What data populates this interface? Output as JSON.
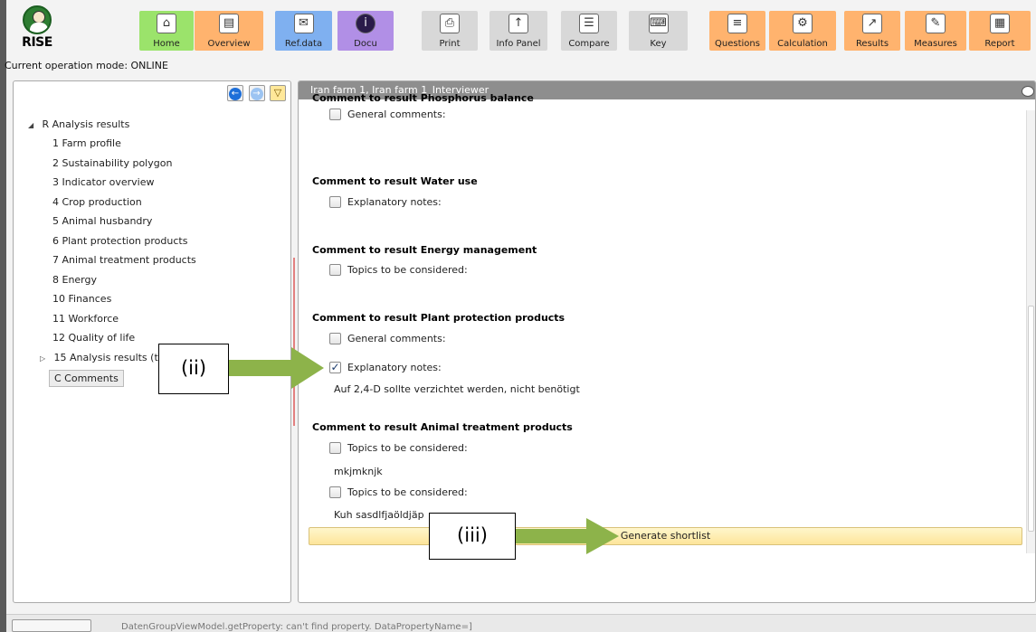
{
  "toolbar": {
    "logo_text": "RISE",
    "buttons": [
      {
        "label": "Home",
        "icon": "home-icon"
      },
      {
        "label": "Overview",
        "icon": "documents-icon"
      },
      {
        "label": "Ref.data",
        "icon": "envelope-icon"
      },
      {
        "label": "Docu",
        "icon": "info-icon"
      },
      {
        "label": "Print",
        "icon": "printer-icon"
      },
      {
        "label": "Info Panel",
        "icon": "upload-icon"
      },
      {
        "label": "Compare",
        "icon": "compare-icon"
      },
      {
        "label": "Key",
        "icon": "keyboard-icon"
      },
      {
        "label": "Questions",
        "icon": "questionnaire-icon"
      },
      {
        "label": "Calculation",
        "icon": "gear-icon"
      },
      {
        "label": "Results",
        "icon": "chart-icon"
      },
      {
        "label": "Measures",
        "icon": "wrench-icon"
      },
      {
        "label": "Report",
        "icon": "report-icon"
      }
    ],
    "colors": {
      "green": "#9be36b",
      "orange": "#ffb36e",
      "blue": "#7fb0f0",
      "purple": "#b18fe6",
      "grey": "#d8d8d8"
    }
  },
  "mode_text": "Current operation mode: ONLINE",
  "left_panel": {
    "root_label": "R Analysis results",
    "items": [
      "1 Farm profile",
      "2 Sustainability polygon",
      "3 Indicator overview",
      "4 Crop production",
      "5 Animal husbandry",
      "6 Plant protection products",
      "7 Animal treatment products",
      "8 Energy",
      "10 Finances",
      "11 Workforce",
      "12 Quality of life"
    ],
    "expandable_item": "15 Analysis results (tab",
    "selected_item": "C Comments"
  },
  "right_panel": {
    "header": "Iran farm 1, Iran farm 1_Interviewer",
    "sections": [
      {
        "title": "Comment to result Phosphorus balance",
        "checks": [
          {
            "label": "General comments:",
            "checked": false
          }
        ]
      },
      {
        "title": "Comment to result Water use",
        "checks": [
          {
            "label": "Explanatory notes:",
            "checked": false
          }
        ]
      },
      {
        "title": "Comment to result Energy management",
        "checks": [
          {
            "label": "Topics to be considered:",
            "checked": false
          }
        ]
      },
      {
        "title": "Comment to result Plant protection products",
        "checks": [
          {
            "label": "General comments:",
            "checked": false
          },
          {
            "label": "Explanatory notes:",
            "checked": true,
            "note": "Auf 2,4-D sollte verzichtet werden, nicht benötigt"
          }
        ]
      },
      {
        "title": "Comment to result Animal treatment products",
        "checks": [
          {
            "label": "Topics to be considered:",
            "checked": false,
            "note": "mkjmknjk"
          },
          {
            "label": "Topics to be considered:",
            "checked": false,
            "note": "Kuh sasdlfjaöldjäp"
          }
        ]
      }
    ],
    "generate_button": "Generate shortlist"
  },
  "annotations": {
    "ii": "(ii)",
    "iii": "(iii)",
    "arrow_color": "#8db34a"
  },
  "status_bar": {
    "text": "DatenGroupViewModel.getProperty: can't find property. DataPropertyName=]"
  }
}
